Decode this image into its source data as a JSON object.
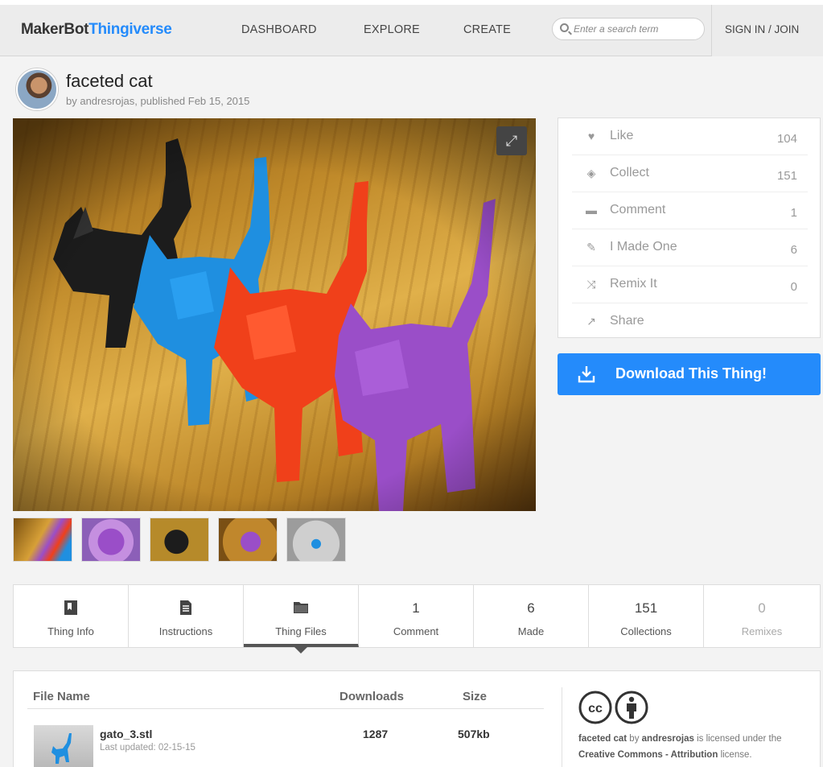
{
  "nav": {
    "logo_maker": "MakerBot",
    "logo_thing": "Thingiverse",
    "links": [
      "DASHBOARD",
      "EXPLORE",
      "CREATE"
    ],
    "search_placeholder": "Enter a search term",
    "signin": "SIGN IN / JOIN"
  },
  "thing": {
    "title": "faceted cat",
    "byline": "by andresrojas, published Feb 15, 2015"
  },
  "stats": [
    {
      "icon": "heart-icon",
      "label": "Like",
      "count": "104"
    },
    {
      "icon": "collect-icon",
      "label": "Collect",
      "count": "151"
    },
    {
      "icon": "comment-icon",
      "label": "Comment",
      "count": "1"
    },
    {
      "icon": "made-icon",
      "label": "I Made One",
      "count": "6"
    },
    {
      "icon": "remix-icon",
      "label": "Remix It",
      "count": "0"
    },
    {
      "icon": "share-icon",
      "label": "Share",
      "count": ""
    }
  ],
  "download_label": "Download This Thing!",
  "tabs": [
    {
      "label": "Thing Info",
      "icon": "thing-info-icon"
    },
    {
      "label": "Instructions",
      "icon": "instructions-icon"
    },
    {
      "label": "Thing Files",
      "icon": "thing-files-icon"
    },
    {
      "label": "Comment",
      "count": "1"
    },
    {
      "label": "Made",
      "count": "6"
    },
    {
      "label": "Collections",
      "count": "151"
    },
    {
      "label": "Remixes",
      "count": "0"
    }
  ],
  "files": {
    "headers": {
      "name": "File Name",
      "downloads": "Downloads",
      "size": "Size"
    },
    "rows": [
      {
        "name": "gato_3.stl",
        "updated": "Last updated: 02-15-15",
        "downloads": "1287",
        "size": "507kb"
      }
    ]
  },
  "license": {
    "thing": "faceted cat",
    "by": "by",
    "author": "andresrojas",
    "mid": "is licensed under the",
    "license_name": "Creative Commons - Attribution",
    "end": "license."
  },
  "colors": {
    "accent": "#248bfb",
    "cat_black": "#1c1c1c",
    "cat_blue": "#1f8fe0",
    "cat_red": "#f0401a",
    "cat_purple": "#9a4ec8"
  }
}
